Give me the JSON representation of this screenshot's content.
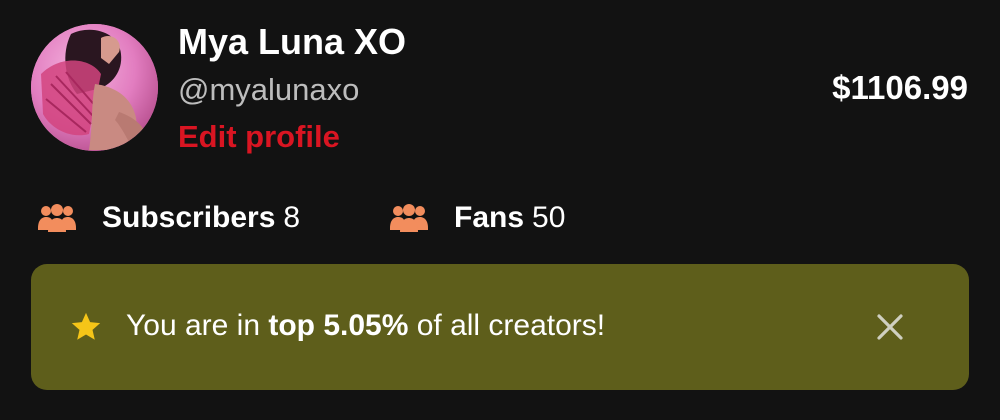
{
  "profile": {
    "name": "Mya Luna XO",
    "handle": "@myalunaxo",
    "edit_label": "Edit profile",
    "avatar_icon": "profile-photo"
  },
  "balance": {
    "amount": "$1106.99"
  },
  "stats": {
    "subscribers": {
      "icon": "group-icon",
      "label": "Subscribers",
      "count": "8"
    },
    "fans": {
      "icon": "group-icon",
      "label": "Fans",
      "count": "50"
    }
  },
  "banner": {
    "icon": "star-icon",
    "text_before": "You are in ",
    "text_bold": "top 5.05%",
    "text_after": " of all creators!",
    "close_icon": "close-icon"
  },
  "colors": {
    "background": "#121212",
    "accent_red": "#d91522",
    "stat_icon": "#f28d5d",
    "banner_bg": "#5e5e1b",
    "star": "#f5c518",
    "close": "#cfcfc0"
  }
}
